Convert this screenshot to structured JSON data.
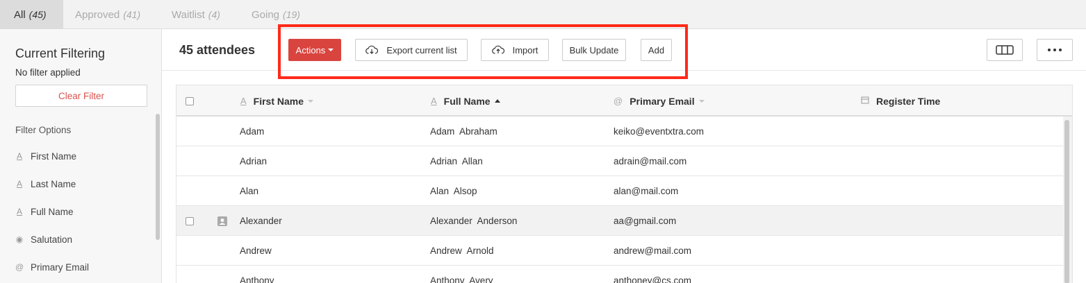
{
  "tabs": [
    {
      "label": "All",
      "count": "(45)"
    },
    {
      "label": "Approved",
      "count": "(41)"
    },
    {
      "label": "Waitlist",
      "count": "(4)"
    },
    {
      "label": "Going",
      "count": "(19)"
    }
  ],
  "sidebar": {
    "title": "Current Filtering",
    "no_filter": "No filter applied",
    "clear_label": "Clear Filter",
    "options_title": "Filter Options",
    "items": [
      {
        "icon": "text-icon",
        "label": "First Name"
      },
      {
        "icon": "text-icon",
        "label": "Last Name"
      },
      {
        "icon": "text-icon",
        "label": "Full Name"
      },
      {
        "icon": "radio-icon",
        "label": "Salutation"
      },
      {
        "icon": "at-icon",
        "label": "Primary Email"
      }
    ]
  },
  "toolbar": {
    "count_title": "45 attendees",
    "actions_label": "Actions",
    "export_label": "Export current list",
    "import_label": "Import",
    "bulk_label": "Bulk Update",
    "add_label": "Add"
  },
  "table": {
    "columns": [
      "First Name",
      "Full Name",
      "Primary Email",
      "Register Time"
    ],
    "rows": [
      {
        "first": "Adam",
        "full": "Adam  Abraham",
        "email": "keiko@eventxtra.com"
      },
      {
        "first": "Adrian",
        "full": "Adrian  Allan",
        "email": "adrain@mail.com"
      },
      {
        "first": "Alan",
        "full": "Alan  Alsop",
        "email": "alan@mail.com"
      },
      {
        "first": "Alexander",
        "full": "Alexander  Anderson",
        "email": "aa@gmail.com"
      },
      {
        "first": "Andrew",
        "full": "Andrew  Arnold",
        "email": "andrew@mail.com"
      },
      {
        "first": "Anthony",
        "full": "Anthony  Avery",
        "email": "anthoney@cs.com"
      }
    ]
  },
  "colors": {
    "accent_red": "#d9443f",
    "highlight": "#ff2a1a",
    "clear_text": "#d9534f"
  }
}
